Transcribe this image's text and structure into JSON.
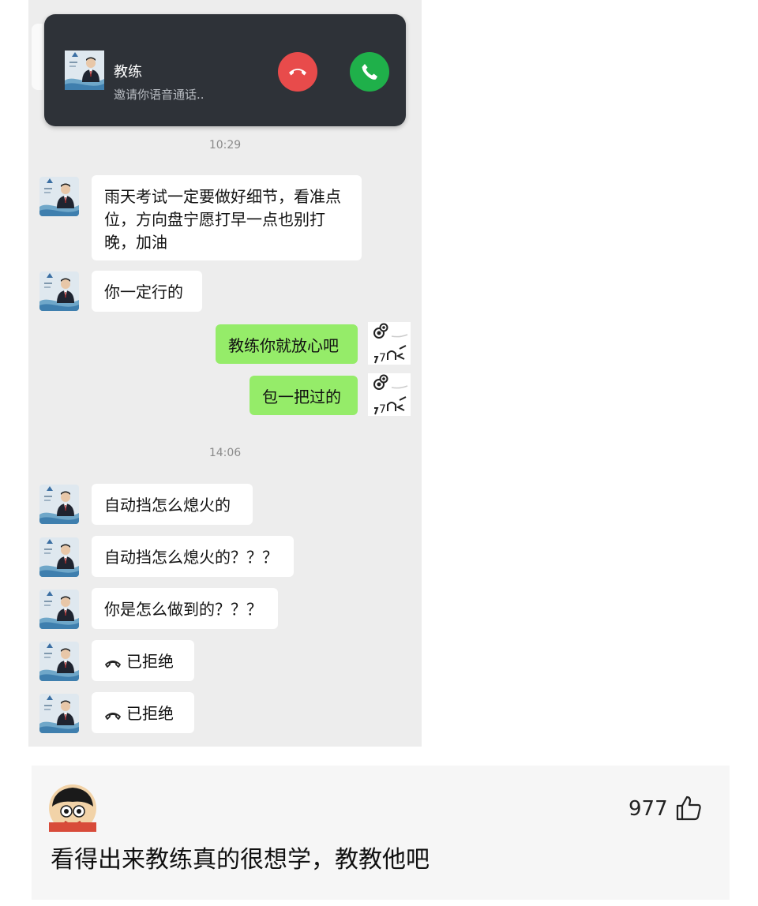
{
  "call": {
    "caller_name": "教练",
    "subtitle": "邀请你语音通话..",
    "decline_icon": "phone-hangup-icon",
    "accept_icon": "phone-icon"
  },
  "chat": {
    "timestamps": [
      "10:29",
      "14:06"
    ],
    "messages": [
      {
        "from": "coach",
        "text": "雨天考试一定要做好细节，看准点位，方向盘宁愿打早一点也别打晚，加油"
      },
      {
        "from": "coach",
        "text": "你一定行的"
      },
      {
        "from": "me",
        "text": "教练你就放心吧"
      },
      {
        "from": "me",
        "text": "包一把过的"
      },
      {
        "from": "coach",
        "text": "自动挡怎么熄火的"
      },
      {
        "from": "coach",
        "text": "自动挡怎么熄火的？？？"
      },
      {
        "from": "coach",
        "text": "你是怎么做到的？？？"
      },
      {
        "from": "coach",
        "text": "已拒绝",
        "icon": "phone-hangup-icon"
      },
      {
        "from": "coach",
        "text": "已拒绝",
        "icon": "phone-hangup-icon"
      }
    ],
    "sticker_icon": "dizzy-cat-sticker-icon"
  },
  "comment": {
    "likes": "977",
    "like_icon": "thumbs-up-icon",
    "text": "看得出来教练真的很想学，教教他吧"
  },
  "colors": {
    "my_bubble": "#95ec69",
    "call_banner": "#2e3238",
    "decline": "#e84b4b",
    "accept": "#1fb04a"
  }
}
